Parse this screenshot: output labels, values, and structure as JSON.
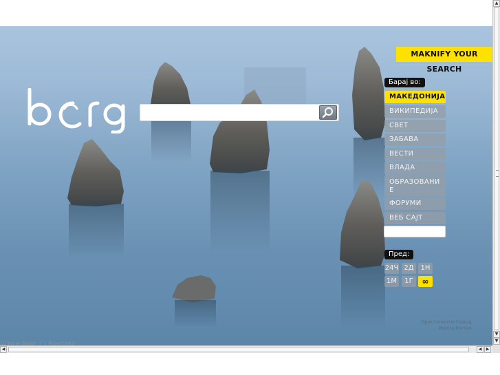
{
  "brand": {
    "logo_text": "borg",
    "maknify_label": "MAKNIFY YOUR SEARCH",
    "accent_color": "#ffe100"
  },
  "search": {
    "value": "",
    "button_icon": "magnifier-icon"
  },
  "categories": {
    "heading": "Барај во:",
    "items": [
      {
        "label": "МАКЕДОНИЈА",
        "active": true
      },
      {
        "label": "ВИКИПЕДИЈА",
        "active": false
      },
      {
        "label": "СВЕТ",
        "active": false
      },
      {
        "label": "ЗАБАВА",
        "active": false
      },
      {
        "label": "ВЕСТИ",
        "active": false
      },
      {
        "label": "ВЛАДА",
        "active": false
      },
      {
        "label": "ОБРАЗОВАНИЕ",
        "active": false
      },
      {
        "label": "ФОРУМИ",
        "active": false
      },
      {
        "label": "ВЕБ САЈТ",
        "active": false
      }
    ],
    "site_value": ""
  },
  "period": {
    "heading": "Пред:",
    "options": [
      {
        "label": "24Ч",
        "active": false
      },
      {
        "label": "2Д",
        "active": false
      },
      {
        "label": "1Н",
        "active": false
      },
      {
        "label": "1М",
        "active": false
      },
      {
        "label": "1Г",
        "active": false
      },
      {
        "label": "∞",
        "active": true
      }
    ]
  },
  "credit": {
    "line1": "Пристапноти Охрид",
    "line2": "Ивана Митик"
  },
  "footer": {
    "about": "Што е Борг ?",
    "separator": "|",
    "contact": "Контакт"
  },
  "scrollbars": {
    "up_icon": "arrow-up-icon",
    "down_icon": "arrow-down-icon",
    "left_icon": "arrow-left-icon",
    "right_icon": "arrow-right-icon"
  }
}
